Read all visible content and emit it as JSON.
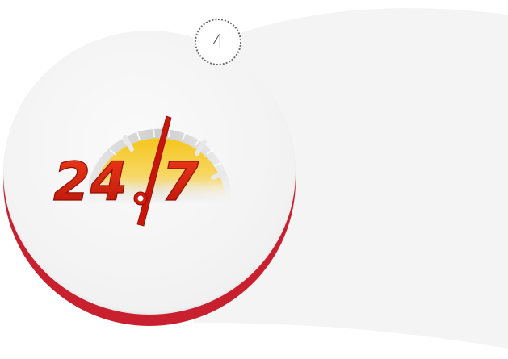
{
  "step": {
    "number": "4"
  },
  "logo": {
    "hours": "24",
    "days": "7",
    "icon": "stopwatch-24-7-icon"
  },
  "colors": {
    "accent_red": "#c8202f",
    "digit_red": "#d81e0e",
    "dial_gold": "#f2c21a",
    "background_grey": "#f4f4f4"
  }
}
